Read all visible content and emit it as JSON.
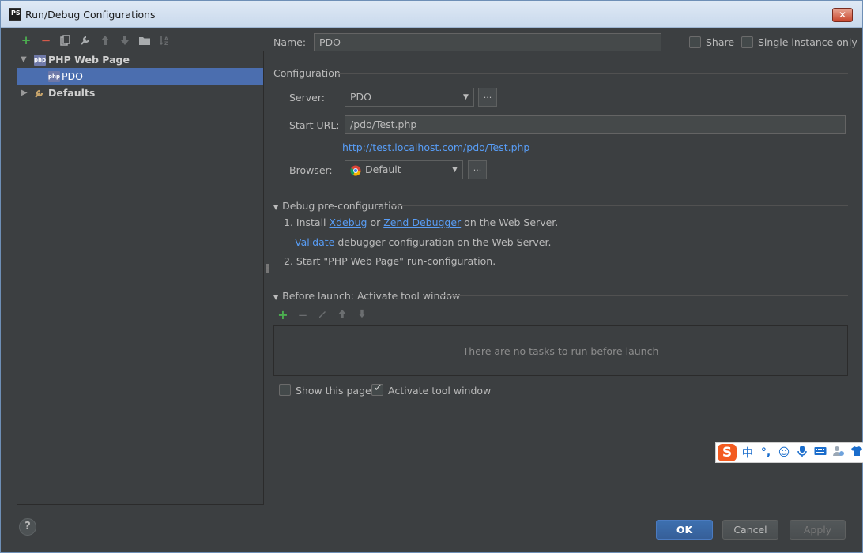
{
  "window": {
    "title": "Run/Debug Configurations",
    "app_icon": "PS",
    "close_glyph": "✕"
  },
  "toolbar": {
    "items": [
      {
        "icon": "add-icon",
        "glyph": "+"
      },
      {
        "icon": "remove-icon",
        "glyph": "−"
      },
      {
        "icon": "copy-icon",
        "glyph": "❐"
      },
      {
        "icon": "edit-defaults-icon",
        "glyph": "🔧"
      },
      {
        "icon": "move-up-icon",
        "glyph": "🠕"
      },
      {
        "icon": "move-down-icon",
        "glyph": "🠗"
      },
      {
        "icon": "folder-icon",
        "glyph": "▬"
      },
      {
        "icon": "sort-icon",
        "glyph": "⇅"
      }
    ]
  },
  "tree": {
    "group_label": "PHP Web Page",
    "group_icon": "php",
    "child_label": "PDO",
    "defaults_label": "Defaults"
  },
  "form": {
    "name_label": "Name:",
    "name_value": "PDO",
    "share_label": "Share",
    "share_checked": false,
    "single_instance_label": "Single instance only",
    "single_instance_checked": false,
    "configuration_title": "Configuration",
    "server_label": "Server:",
    "server_value": "PDO",
    "start_url_label": "Start URL:",
    "start_url_value": "/pdo/Test.php",
    "resolved_url": "http://test.localhost.com/pdo/Test.php",
    "browser_label": "Browser:",
    "browser_value": "Default",
    "ellipsis": "..."
  },
  "debug": {
    "title": "Debug pre-configuration",
    "step1_prefix": "1. Install ",
    "xdebug_link": "Xdebug",
    "or_text": " or ",
    "zend_link": "Zend Debugger",
    "step1_suffix": " on the Web Server.",
    "validate_link": "Validate",
    "validate_suffix": " debugger configuration on the Web Server.",
    "step2": "2. Start \"PHP Web Page\" run-configuration."
  },
  "before_launch": {
    "title": "Before launch: Activate tool window",
    "empty_text": "There are no tasks to run before launch",
    "show_page_label": "Show this page",
    "show_page_checked": false,
    "activate_label": "Activate tool window",
    "activate_checked": true
  },
  "buttons": {
    "ok": "OK",
    "cancel": "Cancel",
    "apply": "Apply",
    "help": "?"
  },
  "ime": {
    "logo": "S",
    "items": [
      "中",
      "°,",
      "☺",
      "🎤",
      "⌨",
      "👤",
      "👕"
    ]
  },
  "colors": {
    "accent": "#4b6eaf",
    "link": "#589df6",
    "add": "#4caf50",
    "remove": "#d35a4a"
  }
}
